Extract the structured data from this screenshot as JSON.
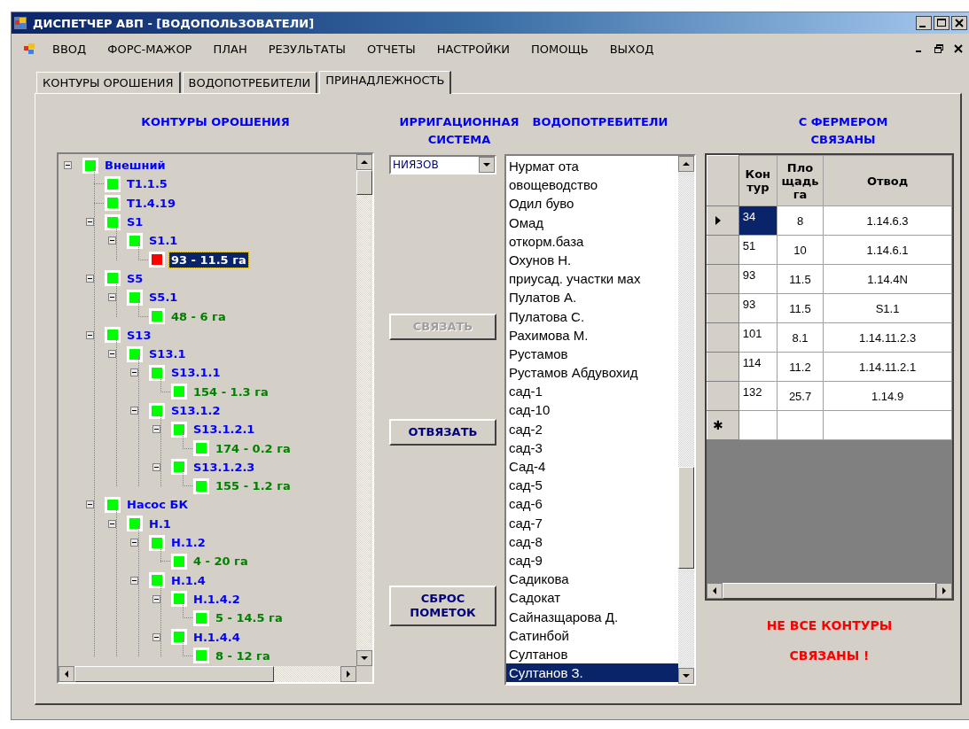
{
  "window": {
    "title": "ДИСПЕТЧЕР АВП - [ВОДОПОЛЬЗОВАТЕЛИ]"
  },
  "menu": [
    "ВВОД",
    "ФОРС-МАЖОР",
    "ПЛАН",
    "РЕЗУЛЬТАТЫ",
    "ОТЧЕТЫ",
    "НАСТРОЙКИ",
    "ПОМОЩЬ",
    "ВЫХОД"
  ],
  "tabs": [
    {
      "label": "КОНТУРЫ ОРОШЕНИЯ",
      "selected": false
    },
    {
      "label": "ВОДОПОТРЕБИТЕЛИ",
      "selected": false
    },
    {
      "label": "ПРИНАДЛЕЖНОСТЬ",
      "selected": true
    }
  ],
  "contours": {
    "title": "КОНТУРЫ ОРОШЕНИЯ",
    "tree": [
      {
        "label": "Внешний",
        "kind": "group",
        "color": "#00ff00",
        "selected": false,
        "expanded": true,
        "children": [
          {
            "label": "T1.1.5",
            "kind": "group",
            "color": "#00ff00",
            "selected": false
          },
          {
            "label": "T1.4.19",
            "kind": "group",
            "color": "#00ff00",
            "selected": false
          },
          {
            "label": "S1",
            "kind": "group",
            "color": "#00ff00",
            "selected": false,
            "expanded": true,
            "children": [
              {
                "label": "S1.1",
                "kind": "group",
                "color": "#00ff00",
                "selected": false,
                "expanded": true,
                "children": [
                  {
                    "label": "93 - 11.5 га",
                    "kind": "contour",
                    "color": "#ff0000",
                    "selected": true
                  }
                ]
              }
            ]
          },
          {
            "label": "S5",
            "kind": "group",
            "color": "#00ff00",
            "selected": false,
            "expanded": true,
            "children": [
              {
                "label": "S5.1",
                "kind": "group",
                "color": "#00ff00",
                "selected": false,
                "expanded": true,
                "children": [
                  {
                    "label": "48 - 6 га",
                    "kind": "contour",
                    "color": "#00ff00",
                    "selected": false
                  }
                ]
              }
            ]
          },
          {
            "label": "S13",
            "kind": "group",
            "color": "#00ff00",
            "selected": false,
            "expanded": true,
            "children": [
              {
                "label": "S13.1",
                "kind": "group",
                "color": "#00ff00",
                "selected": false,
                "expanded": true,
                "children": [
                  {
                    "label": "S13.1.1",
                    "kind": "group",
                    "color": "#00ff00",
                    "selected": false,
                    "expanded": true,
                    "children": [
                      {
                        "label": "154 - 1.3 га",
                        "kind": "contour",
                        "color": "#00ff00",
                        "selected": false
                      }
                    ]
                  },
                  {
                    "label": "S13.1.2",
                    "kind": "group",
                    "color": "#00ff00",
                    "selected": false,
                    "expanded": true,
                    "children": [
                      {
                        "label": "S13.1.2.1",
                        "kind": "group",
                        "color": "#00ff00",
                        "selected": false,
                        "expanded": true,
                        "children": [
                          {
                            "label": "174 - 0.2 га",
                            "kind": "contour",
                            "color": "#00ff00",
                            "selected": false
                          }
                        ]
                      },
                      {
                        "label": "S13.1.2.3",
                        "kind": "group",
                        "color": "#00ff00",
                        "selected": false,
                        "expanded": true,
                        "children": [
                          {
                            "label": "155 - 1.2 га",
                            "kind": "contour",
                            "color": "#00ff00",
                            "selected": false
                          }
                        ]
                      }
                    ]
                  }
                ]
              }
            ]
          },
          {
            "label": "Насос БК",
            "kind": "group",
            "color": "#00ff00",
            "selected": false,
            "expanded": true,
            "children": [
              {
                "label": "H.1",
                "kind": "group",
                "color": "#00ff00",
                "selected": false,
                "expanded": true,
                "children": [
                  {
                    "label": "H.1.2",
                    "kind": "group",
                    "color": "#00ff00",
                    "selected": false,
                    "expanded": true,
                    "children": [
                      {
                        "label": "4 - 20 га",
                        "kind": "contour",
                        "color": "#00ff00",
                        "selected": false
                      }
                    ]
                  },
                  {
                    "label": "H.1.4",
                    "kind": "group",
                    "color": "#00ff00",
                    "selected": false,
                    "expanded": true,
                    "children": [
                      {
                        "label": "H.1.4.2",
                        "kind": "group",
                        "color": "#00ff00",
                        "selected": false,
                        "expanded": true,
                        "children": [
                          {
                            "label": "5 - 14.5 га",
                            "kind": "contour",
                            "color": "#00ff00",
                            "selected": false
                          }
                        ]
                      },
                      {
                        "label": "H.1.4.4",
                        "kind": "group",
                        "color": "#00ff00",
                        "selected": false,
                        "expanded": true,
                        "children": [
                          {
                            "label": "8 - 12 га",
                            "kind": "contour",
                            "color": "#00ff00",
                            "selected": false
                          }
                        ]
                      }
                    ]
                  }
                ]
              }
            ]
          }
        ]
      }
    ]
  },
  "system": {
    "title": "ИРРИГАЦИОННАЯ СИСТЕМА",
    "value": "НИЯЗОВ"
  },
  "buttons": [
    {
      "label": "СВЯЗАТЬ",
      "disabled": true
    },
    {
      "label": "ОТВЯЗАТЬ",
      "disabled": false
    },
    {
      "label": "СБРОС ПОМЕТОК",
      "disabled": false
    }
  ],
  "consumers": {
    "title": "ВОДОПОТРЕБИТЕЛИ",
    "items": [
      {
        "label": "Нурмат ота",
        "selected": false
      },
      {
        "label": "овощеводство",
        "selected": false
      },
      {
        "label": "Одил буво",
        "selected": false
      },
      {
        "label": "Омад",
        "selected": false
      },
      {
        "label": "откорм.база",
        "selected": false
      },
      {
        "label": "Охунов Н.",
        "selected": false
      },
      {
        "label": "приусад. участки мах",
        "selected": false
      },
      {
        "label": "Пулатов А.",
        "selected": false
      },
      {
        "label": "Пулатова С.",
        "selected": false
      },
      {
        "label": "Рахимова М.",
        "selected": false
      },
      {
        "label": "Рустамов",
        "selected": false
      },
      {
        "label": "Рустамов Абдувохид",
        "selected": false
      },
      {
        "label": "сад-1",
        "selected": false
      },
      {
        "label": "сад-10",
        "selected": false
      },
      {
        "label": "сад-2",
        "selected": false
      },
      {
        "label": "сад-3",
        "selected": false
      },
      {
        "label": "Сад-4",
        "selected": false
      },
      {
        "label": "сад-5",
        "selected": false
      },
      {
        "label": "сад-6",
        "selected": false
      },
      {
        "label": "сад-7",
        "selected": false
      },
      {
        "label": "сад-8",
        "selected": false
      },
      {
        "label": "сад-9",
        "selected": false
      },
      {
        "label": "Садикова",
        "selected": false
      },
      {
        "label": "Садокат",
        "selected": false
      },
      {
        "label": "Сайназщарова Д.",
        "selected": false
      },
      {
        "label": "Сатинбой",
        "selected": false
      },
      {
        "label": "Султанов",
        "selected": false
      },
      {
        "label": "Султанов З.",
        "selected": true
      }
    ]
  },
  "linked": {
    "title": "С ФЕРМЕРОМ СВЯЗАНЫ",
    "columns": [
      "Кон тур",
      "Пло щадь га",
      "Отвод"
    ],
    "rows": [
      {
        "cells": [
          "34",
          "8",
          "1.14.6.3"
        ],
        "current": true
      },
      {
        "cells": [
          "51",
          "10",
          "1.14.6.1"
        ],
        "current": false
      },
      {
        "cells": [
          "93",
          "11.5",
          "1.14.4N"
        ],
        "current": false
      },
      {
        "cells": [
          "93",
          "11.5",
          "S1.1"
        ],
        "current": false
      },
      {
        "cells": [
          "101",
          "8.1",
          "1.14.11.2.3"
        ],
        "current": false
      },
      {
        "cells": [
          "114",
          "11.2",
          "1.14.11.2.1"
        ],
        "current": false
      },
      {
        "cells": [
          "132",
          "25.7",
          "1.14.9"
        ],
        "current": false
      }
    ],
    "new_row_marker": "✱"
  },
  "warning": [
    "НЕ ВСЕ КОНТУРЫ",
    "СВЯЗАНЫ !"
  ]
}
